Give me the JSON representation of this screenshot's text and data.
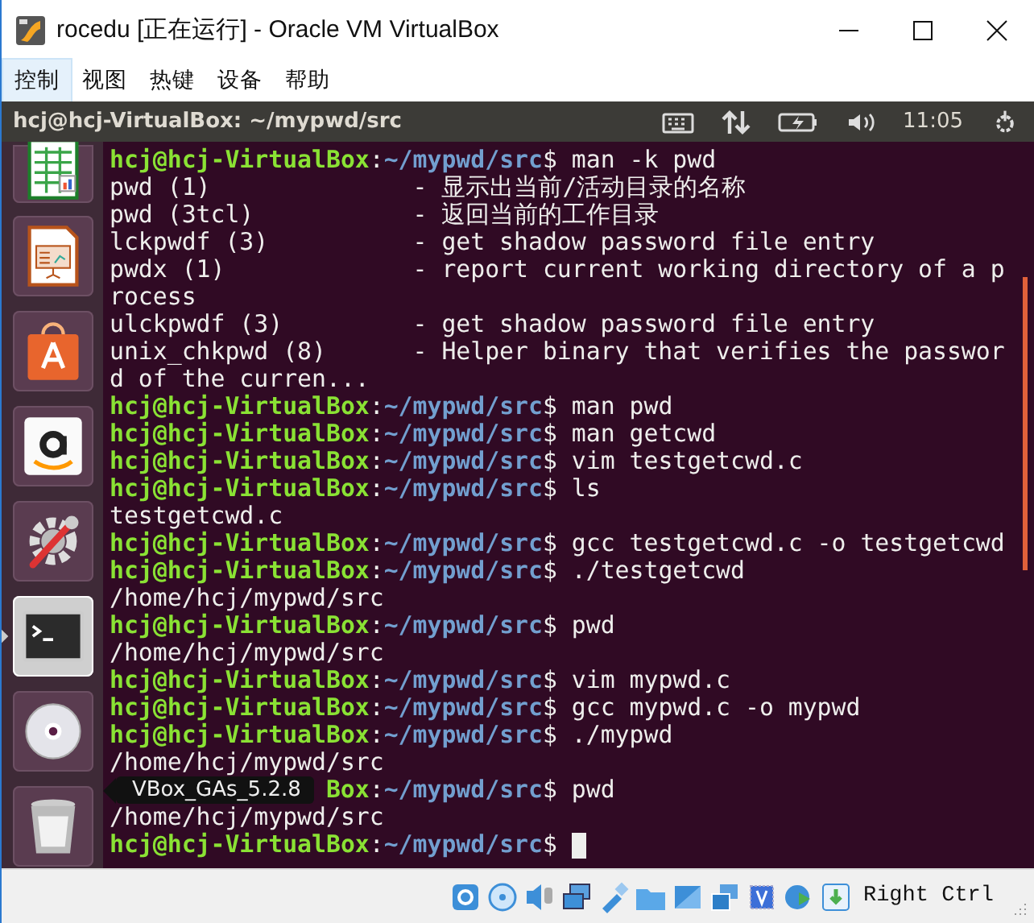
{
  "window": {
    "title": "rocedu [正在运行] - Oracle VM VirtualBox"
  },
  "menu": [
    {
      "label": "控制",
      "selected": true
    },
    {
      "label": "视图",
      "selected": false
    },
    {
      "label": "热键",
      "selected": false
    },
    {
      "label": "设备",
      "selected": false
    },
    {
      "label": "帮助",
      "selected": false
    }
  ],
  "top_panel": {
    "title": "hcj@hcj-VirtualBox: ~/mypwd/src",
    "clock": "11:05"
  },
  "launcher": [
    {
      "kind": "spreadsheet",
      "selected": false
    },
    {
      "kind": "presentation",
      "selected": false
    },
    {
      "kind": "store",
      "selected": false
    },
    {
      "kind": "amazon",
      "selected": false
    },
    {
      "kind": "settings",
      "selected": false
    },
    {
      "kind": "terminal",
      "selected": true
    },
    {
      "kind": "disc",
      "selected": false
    },
    {
      "kind": "trash",
      "selected": false
    }
  ],
  "tooltip": "VBox_GAs_5.2.8",
  "terminal": [
    {
      "kind": "prompt",
      "user": "hcj@hcj-VirtualBox",
      "sep": ":",
      "path": "~/mypwd/src",
      "mark": "$",
      "cmd": "man -k pwd"
    },
    {
      "kind": "output",
      "text": "pwd (1)              - 显示出当前/活动目录的名称"
    },
    {
      "kind": "output",
      "text": "pwd (3tcl)           - 返回当前的工作目录"
    },
    {
      "kind": "output",
      "text": "lckpwdf (3)          - get shadow password file entry"
    },
    {
      "kind": "output",
      "text": "pwdx (1)             - report current working directory of a p"
    },
    {
      "kind": "output",
      "text": "rocess"
    },
    {
      "kind": "output",
      "text": "ulckpwdf (3)         - get shadow password file entry"
    },
    {
      "kind": "output",
      "text": "unix_chkpwd (8)      - Helper binary that verifies the passwor"
    },
    {
      "kind": "output",
      "text": "d of the curren..."
    },
    {
      "kind": "prompt",
      "user": "hcj@hcj-VirtualBox",
      "sep": ":",
      "path": "~/mypwd/src",
      "mark": "$",
      "cmd": "man pwd"
    },
    {
      "kind": "prompt",
      "user": "hcj@hcj-VirtualBox",
      "sep": ":",
      "path": "~/mypwd/src",
      "mark": "$",
      "cmd": "man getcwd"
    },
    {
      "kind": "prompt",
      "user": "hcj@hcj-VirtualBox",
      "sep": ":",
      "path": "~/mypwd/src",
      "mark": "$",
      "cmd": "vim testgetcwd.c"
    },
    {
      "kind": "prompt",
      "user": "hcj@hcj-VirtualBox",
      "sep": ":",
      "path": "~/mypwd/src",
      "mark": "$",
      "cmd": "ls"
    },
    {
      "kind": "output",
      "text": "testgetcwd.c"
    },
    {
      "kind": "prompt",
      "user": "hcj@hcj-VirtualBox",
      "sep": ":",
      "path": "~/mypwd/src",
      "mark": "$",
      "cmd": "gcc testgetcwd.c -o testgetcwd"
    },
    {
      "kind": "prompt",
      "user": "hcj@hcj-VirtualBox",
      "sep": ":",
      "path": "~/mypwd/src",
      "mark": "$",
      "cmd": "./testgetcwd"
    },
    {
      "kind": "output",
      "text": "/home/hcj/mypwd/src"
    },
    {
      "kind": "prompt",
      "user": "hcj@hcj-VirtualBox",
      "sep": ":",
      "path": "~/mypwd/src",
      "mark": "$",
      "cmd": "pwd"
    },
    {
      "kind": "output",
      "text": "/home/hcj/mypwd/src"
    },
    {
      "kind": "prompt",
      "user": "hcj@hcj-VirtualBox",
      "sep": ":",
      "path": "~/mypwd/src",
      "mark": "$",
      "cmd": "vim mypwd.c"
    },
    {
      "kind": "prompt",
      "user": "hcj@hcj-VirtualBox",
      "sep": ":",
      "path": "~/mypwd/src",
      "mark": "$",
      "cmd": "gcc mypwd.c -o mypwd"
    },
    {
      "kind": "prompt",
      "user": "hcj@hcj-VirtualBox",
      "sep": ":",
      "path": "~/mypwd/src",
      "mark": "$",
      "cmd": "./mypwd"
    },
    {
      "kind": "output",
      "text": "/home/hcj/mypwd/src"
    },
    {
      "kind": "covered",
      "user": "Box",
      "sep": ":",
      "path": "~/mypwd/src",
      "mark": "$",
      "cmd": "pwd"
    },
    {
      "kind": "output",
      "text": "/home/hcj/mypwd/src"
    },
    {
      "kind": "cursor",
      "user": "hcj@hcj-VirtualBox",
      "sep": ":",
      "path": "~/mypwd/src",
      "mark": "$"
    }
  ],
  "status_bar": {
    "host_key": "Right Ctrl"
  }
}
